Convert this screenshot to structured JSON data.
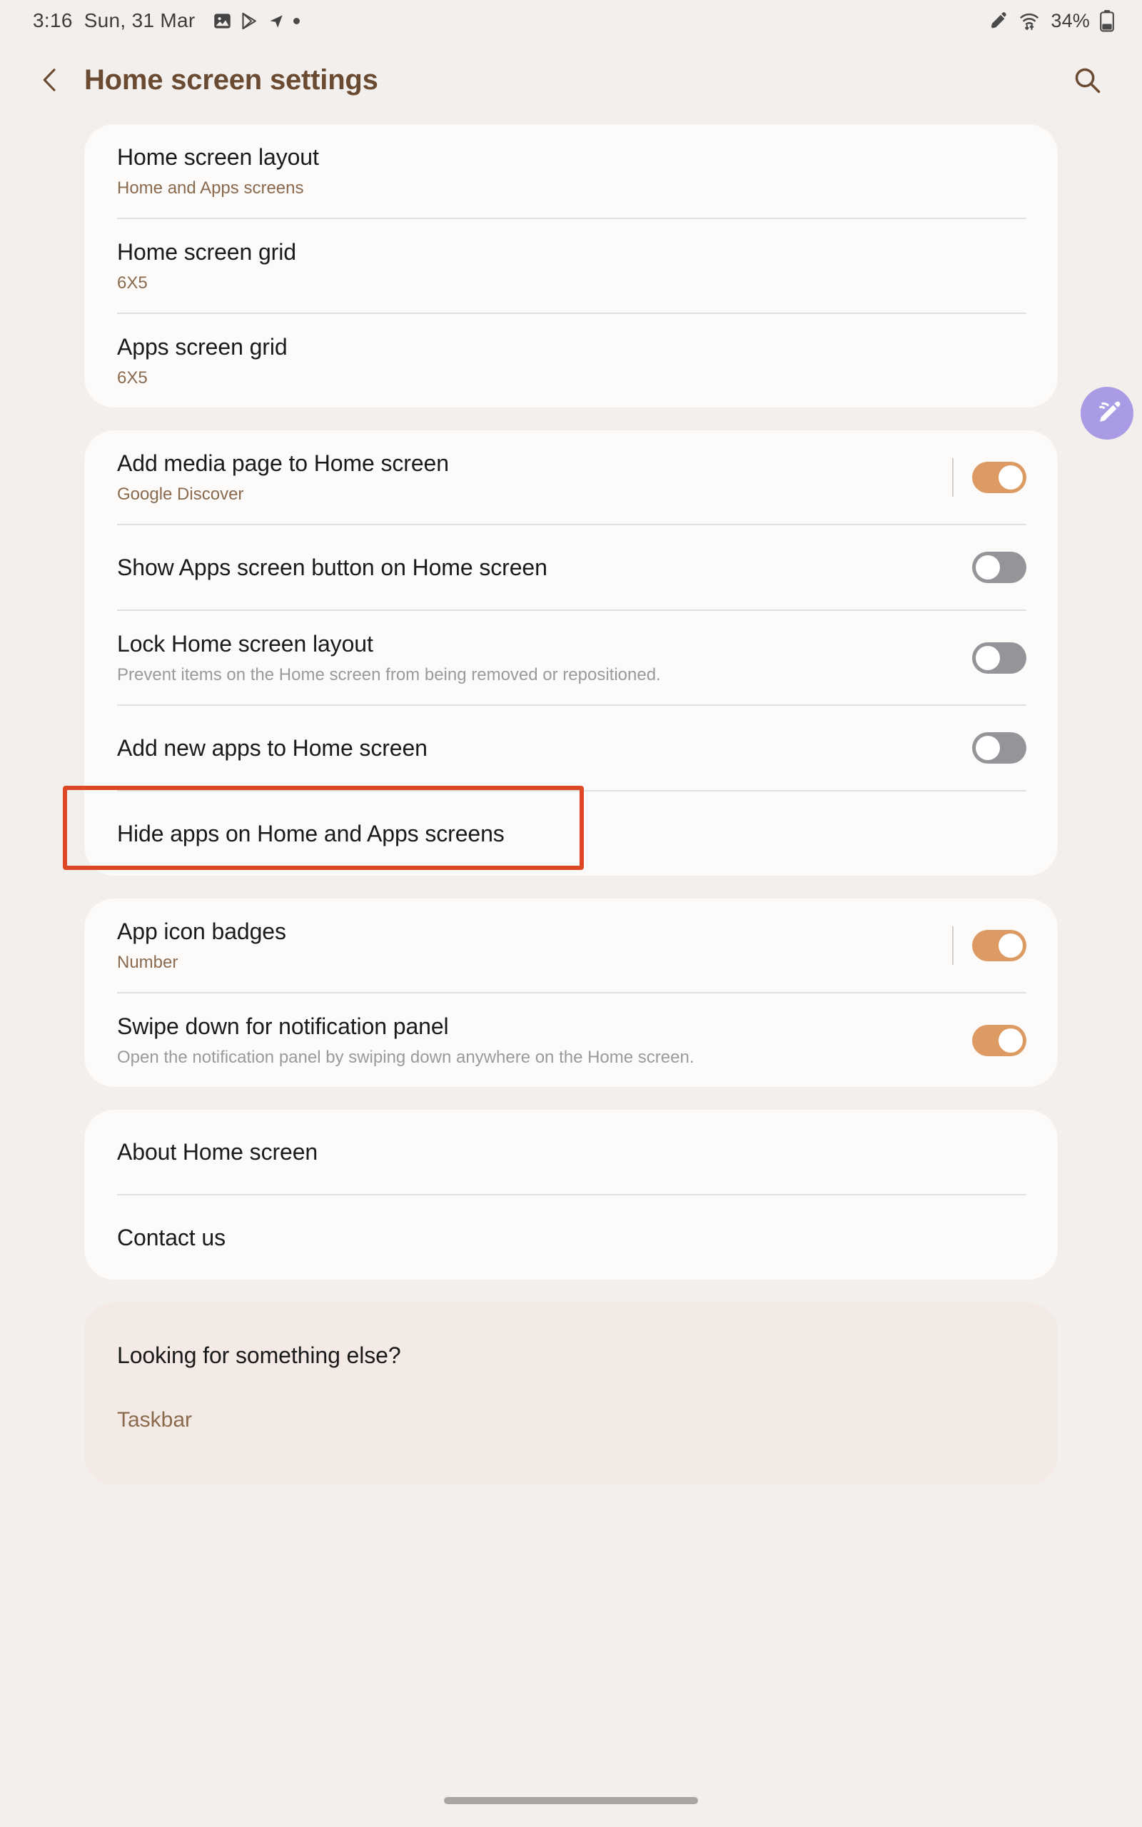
{
  "status_bar": {
    "time": "3:16",
    "date": "Sun, 31 Mar",
    "notification_icons": [
      "image-icon",
      "play-store-icon",
      "navigation-arrow-icon",
      "dot-icon"
    ],
    "right_icons": [
      "stylus-icon",
      "wifi-icon"
    ],
    "battery_percent": "34%",
    "battery_icon": "battery-icon"
  },
  "header": {
    "back_icon": "chevron-left-icon",
    "title": "Home screen settings",
    "search_icon": "search-icon"
  },
  "floating_button": {
    "icon": "s-pen-air-command-icon",
    "color": "#A99CE4"
  },
  "highlight": {
    "color": "#DE4726",
    "target": "Hide apps on Home and Apps screens"
  },
  "colors": {
    "page_background": "#F3EFEC",
    "card_background": "#FCFBFA",
    "tinted_card_background": "#F4EAE5",
    "accent_brown": "#6B4A32",
    "summary_brown": "#8A6A4F",
    "toggle_on": "#DD9A62",
    "toggle_off": "#949499",
    "divider": "#E3E1E0"
  },
  "cards": [
    {
      "id": "layout-card",
      "tinted": false,
      "rows": [
        {
          "name": "home-screen-layout",
          "title": "Home screen layout",
          "summary": "Home and Apps screens",
          "summary_style": "accent",
          "control": "none"
        },
        {
          "name": "home-screen-grid",
          "title": "Home screen grid",
          "summary": "6X5",
          "summary_style": "accent",
          "control": "none"
        },
        {
          "name": "apps-screen-grid",
          "title": "Apps screen grid",
          "summary": "6X5",
          "summary_style": "accent",
          "control": "none"
        }
      ]
    },
    {
      "id": "behavior-card",
      "tinted": false,
      "rows": [
        {
          "name": "add-media-page",
          "title": "Add media page to Home screen",
          "summary": "Google Discover",
          "summary_style": "accent",
          "control": "toggle",
          "toggle_state": "on",
          "has_separator": true
        },
        {
          "name": "show-apps-screen-button",
          "title": "Show Apps screen button on Home screen",
          "summary": "",
          "control": "toggle",
          "toggle_state": "off",
          "has_separator": false
        },
        {
          "name": "lock-home-screen-layout",
          "title": "Lock Home screen layout",
          "summary": "Prevent items on the Home screen from being removed or repositioned.",
          "summary_style": "gray",
          "control": "toggle",
          "toggle_state": "off",
          "has_separator": false
        },
        {
          "name": "add-new-apps",
          "title": "Add new apps to Home screen",
          "summary": "",
          "control": "toggle",
          "toggle_state": "off",
          "has_separator": false
        },
        {
          "name": "hide-apps",
          "title": "Hide apps on Home and Apps screens",
          "summary": "",
          "control": "none",
          "highlighted": true
        }
      ]
    },
    {
      "id": "badges-card",
      "tinted": false,
      "rows": [
        {
          "name": "app-icon-badges",
          "title": "App icon badges",
          "summary": "Number",
          "summary_style": "accent",
          "control": "toggle",
          "toggle_state": "on",
          "has_separator": true
        },
        {
          "name": "swipe-down-notification-panel",
          "title": "Swipe down for notification panel",
          "summary": "Open the notification panel by swiping down anywhere on the Home screen.",
          "summary_style": "gray",
          "control": "toggle",
          "toggle_state": "on",
          "has_separator": false
        }
      ]
    },
    {
      "id": "info-card",
      "tinted": false,
      "rows": [
        {
          "name": "about-home-screen",
          "title": "About Home screen",
          "summary": "",
          "control": "none"
        },
        {
          "name": "contact-us",
          "title": "Contact us",
          "summary": "",
          "control": "none"
        }
      ]
    },
    {
      "id": "looking-for-card",
      "tinted": true,
      "rows": [
        {
          "name": "looking-for-something-else",
          "title": "Looking for something else?",
          "summary": "",
          "control": "none",
          "no_divider": true
        },
        {
          "name": "taskbar-link",
          "title": "",
          "summary": "Taskbar",
          "summary_style": "accent",
          "control": "none",
          "link_only": true
        }
      ]
    }
  ],
  "nav_bar": {
    "home_indicator": "home-gesture-bar"
  }
}
